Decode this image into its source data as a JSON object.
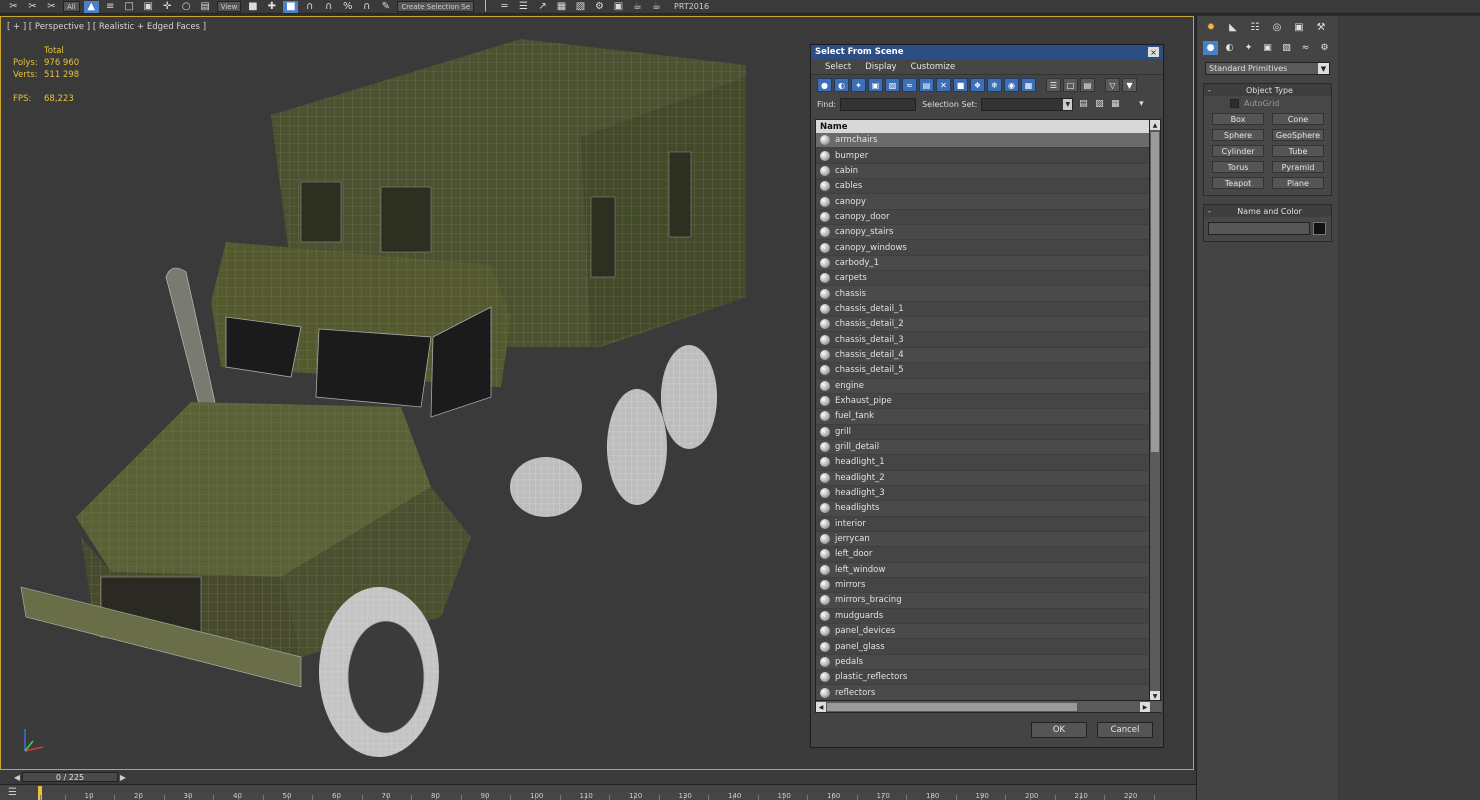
{
  "toolbar": {
    "dropdown_all": "All",
    "dropdown_view": "View",
    "dropdown_selection": "Create Selection Se",
    "prt_label": "PRT2016"
  },
  "viewport": {
    "label": "[ + ] [ Perspective ] [ Realistic + Edged Faces ]",
    "stats": {
      "header": "Total",
      "polys_label": "Polys:",
      "polys_value": "976 960",
      "verts_label": "Verts:",
      "verts_value": "511 298",
      "fps_label": "FPS:",
      "fps_value": "68,223"
    }
  },
  "dialog": {
    "title": "Select From Scene",
    "close": "×",
    "menu": [
      "Select",
      "Display",
      "Customize"
    ],
    "find_label": "Find:",
    "selection_set_label": "Selection Set:",
    "column_name": "Name",
    "items": [
      "armchairs",
      "bumper",
      "cabin",
      "cables",
      "canopy",
      "canopy_door",
      "canopy_stairs",
      "canopy_windows",
      "carbody_1",
      "carpets",
      "chassis",
      "chassis_detail_1",
      "chassis_detail_2",
      "chassis_detail_3",
      "chassis_detail_4",
      "chassis_detail_5",
      "engine",
      "Exhaust_pipe",
      "fuel_tank",
      "grill",
      "grill_detail",
      "headlight_1",
      "headlight_2",
      "headlight_3",
      "headlights",
      "interior",
      "jerrycan",
      "left_door",
      "left_window",
      "mirrors",
      "mirrors_bracing",
      "mudguards",
      "panel_devices",
      "panel_glass",
      "pedals",
      "plastic_reflectors",
      "reflectors"
    ],
    "selected_item": "armchairs",
    "ok_label": "OK",
    "cancel_label": "Cancel"
  },
  "command_panel": {
    "primitive_type": "Standard Primitives",
    "object_type_title": "Object Type",
    "autogrid_label": "AutoGrid",
    "buttons": [
      "Box",
      "Cone",
      "Sphere",
      "GeoSphere",
      "Cylinder",
      "Tube",
      "Torus",
      "Pyramid",
      "Teapot",
      "Plane"
    ],
    "name_color_title": "Name and Color"
  },
  "timeline": {
    "frame": "0 / 225",
    "ticks": [
      "10",
      "20",
      "30",
      "40",
      "50",
      "60",
      "70",
      "80",
      "90",
      "100",
      "110",
      "120",
      "130",
      "140",
      "150",
      "160",
      "170",
      "180",
      "190",
      "200",
      "210",
      "220"
    ]
  },
  "colors": {
    "accent": "#4a7fc9",
    "viewport_border": "#c9a534",
    "stats_text": "#e8c23a",
    "title_bar": "#2b4e85"
  }
}
